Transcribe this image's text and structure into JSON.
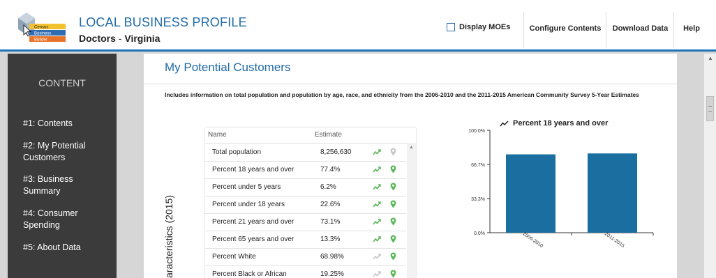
{
  "header": {
    "logo": {
      "line1": "Census",
      "line2": "Business",
      "line3": "Builder"
    },
    "title": "LOCAL BUSINESS PROFILE",
    "subtitle_business": "Doctors",
    "subtitle_sep": " - ",
    "subtitle_place": "Virginia",
    "moe_label": "Display MOEs",
    "moe_checked": false,
    "nav": [
      "Configure Contents",
      "Download Data",
      "Help"
    ]
  },
  "sidebar": {
    "heading": "CONTENT",
    "items": [
      "#1: Contents",
      "#2: My Potential Customers",
      "#3: Business Summary",
      "#4: Consumer Spending",
      "#5: About Data"
    ]
  },
  "main": {
    "section_title": "My Potential Customers",
    "description": "Includes information on total population and population by age, race, and ethnicity from the 2006-2010 and the 2011-2015 American Community Survey 5-Year Estimates",
    "vertical_label": "aracteristics (2015)",
    "table": {
      "headers": [
        "Name",
        "Estimate"
      ],
      "rows": [
        {
          "name": "Total population",
          "estimate": "8,256,630",
          "trend_active": true,
          "pin_active": false
        },
        {
          "name": "Percent 18 years and over",
          "estimate": "77.4%",
          "trend_active": true,
          "pin_active": true
        },
        {
          "name": "Percent under 5 years",
          "estimate": "6.2%",
          "trend_active": true,
          "pin_active": true
        },
        {
          "name": "Percent under 18 years",
          "estimate": "22.6%",
          "trend_active": true,
          "pin_active": true
        },
        {
          "name": "Percent 21 years and over",
          "estimate": "73.1%",
          "trend_active": true,
          "pin_active": true
        },
        {
          "name": "Percent 65 years and over",
          "estimate": "13.3%",
          "trend_active": true,
          "pin_active": true
        },
        {
          "name": "Percent White",
          "estimate": "68.98%",
          "trend_active": false,
          "pin_active": true
        },
        {
          "name": "Percent Black or African",
          "estimate": "19.25%",
          "trend_active": false,
          "pin_active": true
        }
      ]
    }
  },
  "colors": {
    "accent": "#1f74b6",
    "bar": "#1a6fa0",
    "icon_green": "#5cb85c",
    "icon_gray": "#c8c8c8",
    "sidebar": "#3b3b3b"
  },
  "chart_data": {
    "type": "bar",
    "title": "Percent 18 years and over",
    "categories": [
      "2006-2010",
      "2011-2015"
    ],
    "values": [
      76.5,
      77.4
    ],
    "ylim": [
      0,
      100
    ],
    "yticks": [
      "0.0%",
      "33.3%",
      "66.7%",
      "100.0%"
    ],
    "ytick_values": [
      0,
      33.3,
      66.7,
      100
    ],
    "grid": false
  }
}
